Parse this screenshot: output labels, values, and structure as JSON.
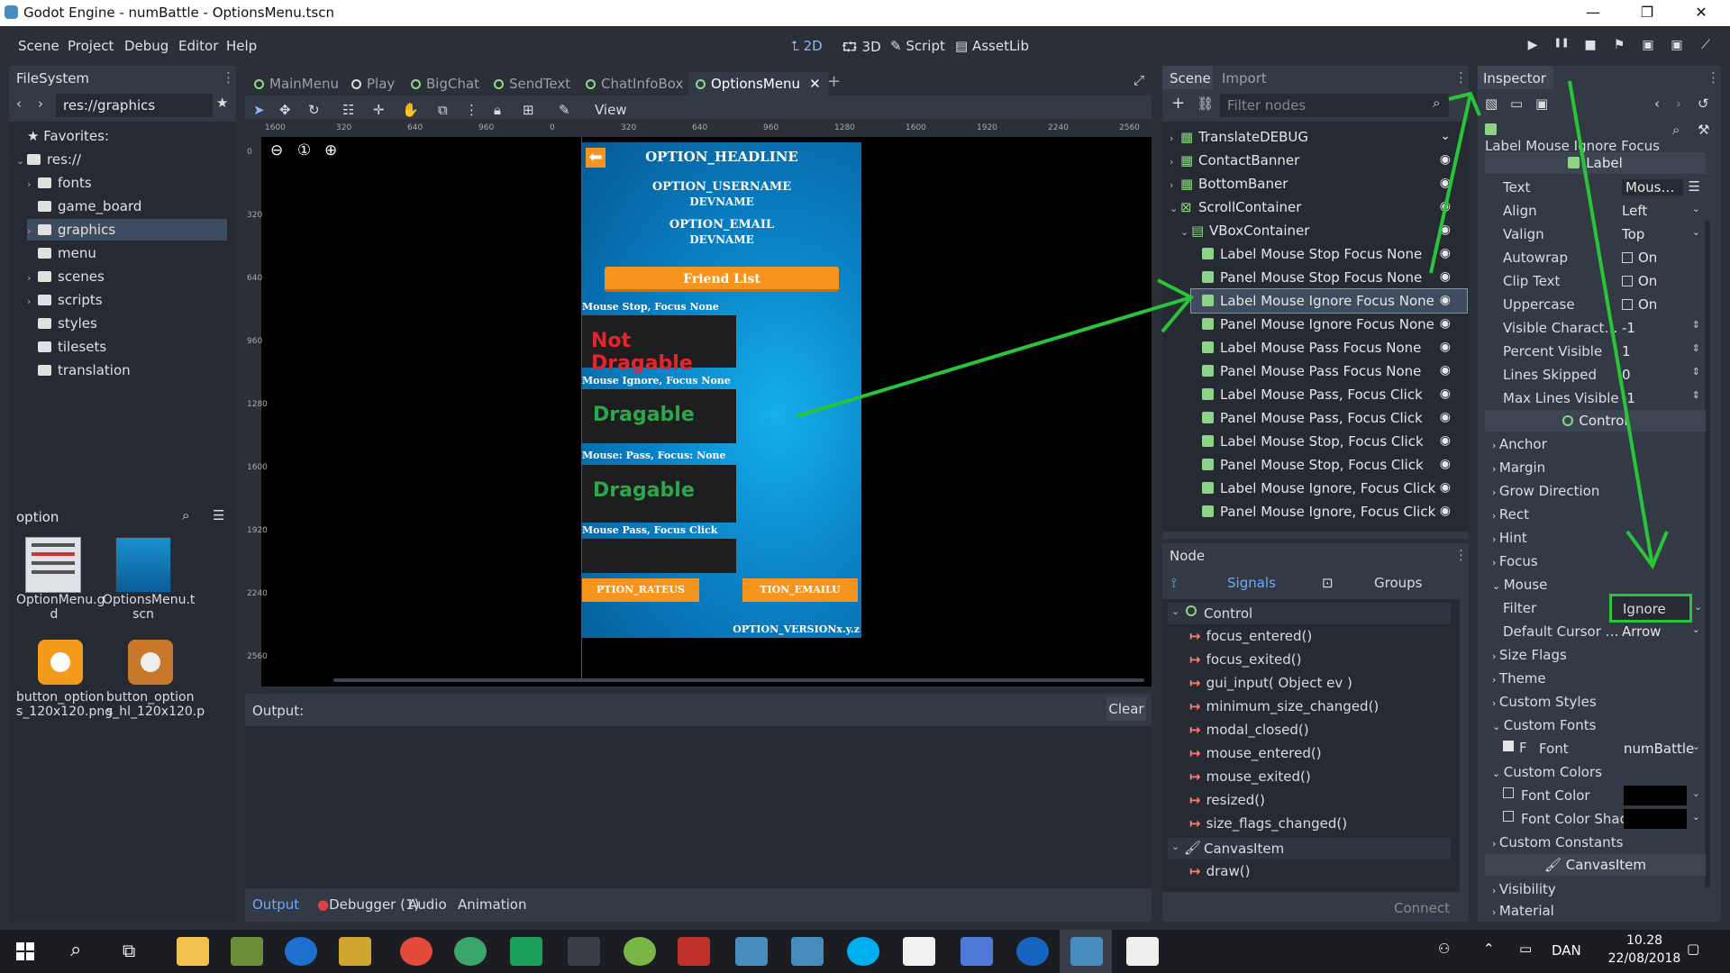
{
  "window": {
    "title": "Godot Engine - numBattle - OptionsMenu.tscn",
    "minimize": "—",
    "maximize": "❐",
    "close": "✕"
  },
  "menubar": {
    "items": [
      "Scene",
      "Project",
      "Debug",
      "Editor",
      "Help"
    ]
  },
  "modes": {
    "2d": "2D",
    "3d": "3D",
    "script": "Script",
    "assetlib": "AssetLib"
  },
  "playbar": {
    "play": "▶",
    "pause": "❚❚",
    "stop": "■"
  },
  "filesystem": {
    "title": "FileSystem",
    "path": "res://graphics",
    "favorites": "Favorites:",
    "root": "res://",
    "folders": [
      "fonts",
      "game_board",
      "graphics",
      "menu",
      "scenes",
      "scripts",
      "styles",
      "tilesets",
      "translation"
    ],
    "search": "option",
    "files": [
      {
        "name": "OptionMenu.gd",
        "line1": "OptionMenu.g",
        "line2": "d"
      },
      {
        "name": "OptionsMenu.tscn",
        "line1": "OptionsMenu.t",
        "line2": "scn"
      },
      {
        "name": "button_options_120x120.png",
        "line1": "button_option",
        "line2": "s_120x120.png"
      },
      {
        "name": "button_options_hl_120x120.png",
        "line1": "button_option",
        "line2": "s_hl_120x120.p"
      }
    ]
  },
  "tabs": [
    {
      "label": "MainMenu"
    },
    {
      "label": "Play"
    },
    {
      "label": "BigChat"
    },
    {
      "label": "SendText"
    },
    {
      "label": "ChatInfoBox"
    },
    {
      "label": "OptionsMenu",
      "active": true
    }
  ],
  "toolbar": {
    "view": "View"
  },
  "ruler": {
    "h": [
      "1600",
      "320",
      "640",
      "960",
      "0",
      "320",
      "640",
      "960",
      "1280",
      "1600",
      "1920",
      "2240",
      "2560"
    ],
    "v": [
      "0",
      "320",
      "640",
      "960",
      "1280",
      "1600",
      "1920",
      "2240",
      "2560"
    ]
  },
  "game": {
    "headline": "OPTION_HEADLINE",
    "username": "OPTION_USERNAME",
    "username_val": "DEVNAME",
    "email": "OPTION_EMAIL",
    "email_val": "DEVNAME",
    "friend_list": "Friend List",
    "lbl1": "Mouse Stop, Focus None",
    "box1": "Not Dragable",
    "lbl2": "Mouse Ignore, Focus None",
    "box2": "Dragable",
    "lbl3": "Mouse: Pass, Focus: None",
    "box3": "Dragable",
    "lbl4": "Mouse Pass, Focus Click",
    "btn_rate": "PTION_RATEUS",
    "btn_email": "TION_EMAILU",
    "version": "OPTION_VERSIONx.y.z"
  },
  "output": {
    "label": "Output:",
    "clear": "Clear",
    "tabs": [
      "Output",
      "Debugger (1)",
      "Audio",
      "Animation"
    ]
  },
  "scene": {
    "tabs": [
      "Scene",
      "Import"
    ],
    "filter_placeholder": "Filter nodes",
    "nodes": [
      {
        "name": "TranslateDEBUG",
        "indent": 0
      },
      {
        "name": "ContactBanner",
        "indent": 0
      },
      {
        "name": "BottomBaner",
        "indent": 0
      },
      {
        "name": "ScrollContainer",
        "indent": 0
      },
      {
        "name": "VBoxContainer",
        "indent": 1
      },
      {
        "name": "Label Mouse Stop Focus None",
        "indent": 2
      },
      {
        "name": "Panel Mouse Stop Focus None",
        "indent": 2
      },
      {
        "name": "Label Mouse Ignore Focus None",
        "indent": 2,
        "selected": true
      },
      {
        "name": "Panel Mouse Ignore Focus None",
        "indent": 2
      },
      {
        "name": "Label Mouse Pass Focus None",
        "indent": 2
      },
      {
        "name": "Panel Mouse Pass Focus None",
        "indent": 2
      },
      {
        "name": "Label Mouse Pass, Focus Click",
        "indent": 2
      },
      {
        "name": "Panel Mouse Pass, Focus Click",
        "indent": 2
      },
      {
        "name": "Label Mouse Stop, Focus Click",
        "indent": 2
      },
      {
        "name": "Panel Mouse Stop, Focus Click",
        "indent": 2
      },
      {
        "name": "Label Mouse Ignore, Focus Click",
        "indent": 2
      },
      {
        "name": "Panel Mouse Ignore, Focus Click",
        "indent": 2
      }
    ]
  },
  "node": {
    "title": "Node",
    "signals_tab": "Signals",
    "groups_tab": "Groups",
    "control": "Control",
    "signals": [
      "focus_entered()",
      "focus_exited()",
      "gui_input( Object ev )",
      "minimum_size_changed()",
      "modal_closed()",
      "mouse_entered()",
      "mouse_exited()",
      "resized()",
      "size_flags_changed()"
    ],
    "canvasitem": "CanvasItem",
    "canvas_signals": [
      "draw()"
    ],
    "connect": "Connect"
  },
  "inspector": {
    "title": "Inspector",
    "object": "Label Mouse Ignore Focus",
    "cat_label": "Label",
    "props": [
      {
        "k": "Text",
        "v": "Mouse Ig"
      },
      {
        "k": "Align",
        "v": "Left"
      },
      {
        "k": "Valign",
        "v": "Top"
      },
      {
        "k": "Autowrap",
        "v": "On"
      },
      {
        "k": "Clip Text",
        "v": "On"
      },
      {
        "k": "Uppercase",
        "v": "On"
      },
      {
        "k": "Visible Characters",
        "v": "-1"
      },
      {
        "k": "Percent Visible",
        "v": "1"
      },
      {
        "k": "Lines Skipped",
        "v": "0"
      },
      {
        "k": "Max Lines Visible",
        "v": "-1"
      }
    ],
    "cat_control": "Control",
    "sections1": [
      "Anchor",
      "Margin",
      "Grow Direction",
      "Rect",
      "Hint",
      "Focus",
      "Mouse"
    ],
    "filter_k": "Filter",
    "filter_v": "Ignore",
    "cursor_k": "Default Cursor Sha",
    "cursor_v": "Arrow",
    "sections2": [
      "Size Flags",
      "Theme",
      "Custom Styles",
      "Custom Fonts"
    ],
    "font_k": "Font",
    "font_v": "numBattle",
    "custom_colors": "Custom Colors",
    "font_color": "Font Color",
    "font_color_shad": "Font Color Shad",
    "custom_constants": "Custom Constants",
    "cat_canvasitem": "CanvasItem",
    "visibility": "Visibility",
    "material": "Material"
  },
  "taskbar": {
    "lang": "DAN",
    "time": "10.28",
    "date": "22/08/2018"
  },
  "colors": {
    "accent": "#6fa8ff",
    "selection": "#3f4b5e",
    "highlight_box": "#29c43a"
  }
}
